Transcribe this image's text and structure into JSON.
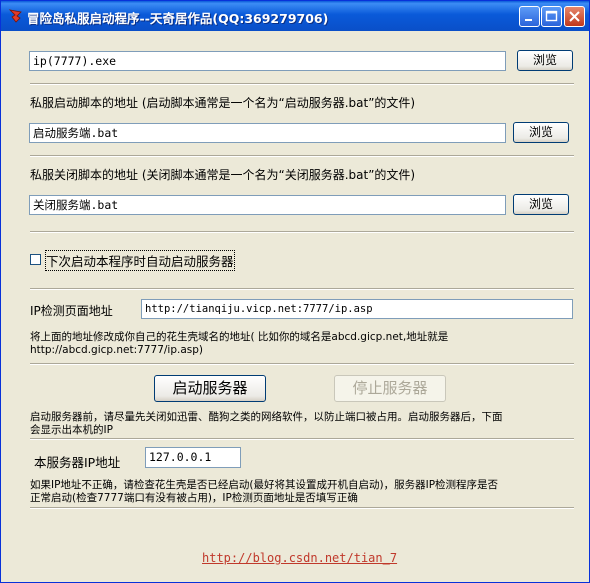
{
  "window": {
    "title": "冒险岛私服启动程序--天奇居作品(QQ:369279706)",
    "controls": [
      "minimize-icon",
      "maximize-icon",
      "close-icon"
    ]
  },
  "exe": {
    "value": "ip(7777).exe",
    "browse_label": "浏览"
  },
  "start_script": {
    "label": "私服启动脚本的地址 (启动脚本通常是一个名为“启动服务器.bat”的文件)",
    "value": "启动服务端.bat",
    "browse_label": "浏览"
  },
  "stop_script": {
    "label": "私服关闭脚本的地址 (关闭脚本通常是一个名为“关闭服务器.bat”的文件)",
    "value": "关闭服务端.bat",
    "browse_label": "浏览"
  },
  "autostart": {
    "label": "下次启动本程序时自动启动服务器",
    "checked": false
  },
  "ip_check": {
    "label": "IP检测页面地址",
    "value": "http://tianqiju.vicp.net:7777/ip.asp",
    "hint_line1": "将上面的地址修改成你自己的花生壳域名的地址( 比如你的域名是abcd.gicp.net,地址就是",
    "hint_line2": "http://abcd.gicp.net:7777/ip.asp)"
  },
  "actions": {
    "start_label": "启动服务器",
    "stop_label": "停止服务器",
    "note_line1": "启动服务器前，请尽量先关闭如迅雷、酷狗之类的网络软件，以防止端口被占用。启动服务器后，下面",
    "note_line2": "会显示出本机的IP"
  },
  "server_ip": {
    "label": "本服务器IP地址",
    "value": "127.0.0.1",
    "note_line1": "如果IP地址不正确，请检查花生壳是否已经启动(最好将其设置成开机自启动)，服务器IP检测程序是否",
    "note_line2": "正常启动(检查7777端口有没有被占用)，IP检测页面地址是否填写正确"
  },
  "footer": {
    "link": "http://blog.csdn.net/tian_7"
  }
}
